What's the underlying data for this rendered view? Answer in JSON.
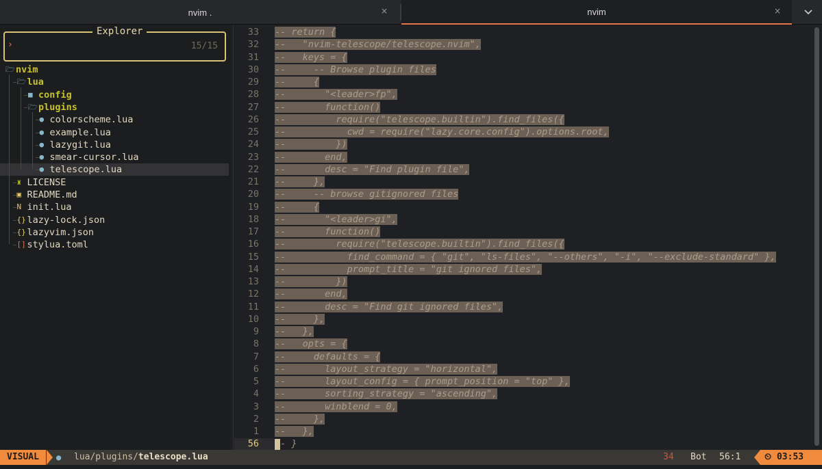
{
  "tabs": [
    {
      "label": "nvim .",
      "close": "×"
    },
    {
      "label": "nvim",
      "close": "×"
    }
  ],
  "tab_menu_icon": "chevron-down-icon",
  "explorer": {
    "title": "Explorer",
    "prompt": "›",
    "count": "15/15",
    "tree": [
      {
        "label": "nvim",
        "type": "dir",
        "icon": "folder-open-icon",
        "depth": 0
      },
      {
        "label": "lua",
        "type": "dir",
        "icon": "folder-open-icon",
        "depth": 1
      },
      {
        "label": "config",
        "type": "dir",
        "icon": "folder-icon",
        "depth": 2
      },
      {
        "label": "plugins",
        "type": "dir",
        "icon": "folder-open-icon",
        "depth": 2
      },
      {
        "label": "colorscheme.lua",
        "type": "file",
        "icon": "lua-icon",
        "depth": 3
      },
      {
        "label": "example.lua",
        "type": "file",
        "icon": "lua-icon",
        "depth": 3
      },
      {
        "label": "lazygit.lua",
        "type": "file",
        "icon": "lua-icon",
        "depth": 3
      },
      {
        "label": "smear-cursor.lua",
        "type": "file",
        "icon": "lua-icon",
        "depth": 3
      },
      {
        "label": "telescope.lua",
        "type": "file",
        "icon": "lua-icon",
        "depth": 3,
        "selected": true
      },
      {
        "label": "LICENSE",
        "type": "file",
        "icon": "license-icon",
        "depth": 1
      },
      {
        "label": "README.md",
        "type": "file",
        "icon": "markdown-icon",
        "depth": 1
      },
      {
        "label": "init.lua",
        "type": "file",
        "icon": "nvim-icon",
        "depth": 1
      },
      {
        "label": "lazy-lock.json",
        "type": "file",
        "icon": "json-icon",
        "depth": 1
      },
      {
        "label": "lazyvim.json",
        "type": "file",
        "icon": "json-icon",
        "depth": 1
      },
      {
        "label": "stylua.toml",
        "type": "file",
        "icon": "toml-icon",
        "depth": 1
      }
    ]
  },
  "editor": {
    "lines": [
      {
        "n": "33",
        "text": "-- return {"
      },
      {
        "n": "32",
        "text": "--   \"nvim-telescope/telescope.nvim\","
      },
      {
        "n": "31",
        "text": "--   keys = {"
      },
      {
        "n": "30",
        "text": "--     -- Browse plugin files"
      },
      {
        "n": "29",
        "text": "--     {"
      },
      {
        "n": "28",
        "text": "--       \"<leader>fp\","
      },
      {
        "n": "27",
        "text": "--       function()"
      },
      {
        "n": "26",
        "text": "--         require(\"telescope.builtin\").find_files({"
      },
      {
        "n": "25",
        "text": "--           cwd = require(\"lazy.core.config\").options.root,"
      },
      {
        "n": "24",
        "text": "--         })"
      },
      {
        "n": "23",
        "text": "--       end,"
      },
      {
        "n": "22",
        "text": "--       desc = \"Find plugin file\","
      },
      {
        "n": "21",
        "text": "--     },"
      },
      {
        "n": "20",
        "text": "--     -- browse gitignored files"
      },
      {
        "n": "19",
        "text": "--     {"
      },
      {
        "n": "18",
        "text": "--       \"<leader>gi\","
      },
      {
        "n": "17",
        "text": "--       function()"
      },
      {
        "n": "16",
        "text": "--         require(\"telescope.builtin\").find_files({"
      },
      {
        "n": "15",
        "text": "--           find_command = { \"git\", \"ls-files\", \"--others\", \"-i\", \"--exclude-standard\" },"
      },
      {
        "n": "14",
        "text": "--           prompt_title = \"git ignored files\","
      },
      {
        "n": "13",
        "text": "--         })"
      },
      {
        "n": "12",
        "text": "--       end,"
      },
      {
        "n": "11",
        "text": "--       desc = \"Find git ignored files\","
      },
      {
        "n": "10",
        "text": "--     },"
      },
      {
        "n": "9",
        "text": "--   },"
      },
      {
        "n": "8",
        "text": "--   opts = {"
      },
      {
        "n": "7",
        "text": "--     defaults = {"
      },
      {
        "n": "6",
        "text": "--       layout_strategy = \"horizontal\","
      },
      {
        "n": "5",
        "text": "--       layout_config = { prompt_position = \"top\" },"
      },
      {
        "n": "4",
        "text": "--       sorting_strategy = \"ascending\","
      },
      {
        "n": "3",
        "text": "--       winblend = 0,"
      },
      {
        "n": "2",
        "text": "--     },"
      },
      {
        "n": "1",
        "text": "--   },"
      },
      {
        "n": "56",
        "text": "-- }",
        "current": true
      }
    ]
  },
  "status": {
    "mode": "VISUAL",
    "file_icon": "lua-icon",
    "path_prefix": "lua/plugins/",
    "path_file": "telescope.lua",
    "selection_count": "34",
    "position_label": "Bot",
    "cursor_pos": "56:1",
    "clock_icon": "clock-icon",
    "time": "03:53"
  },
  "colors": {
    "accent": "#f08a3c",
    "directory": "#c7c22f",
    "selection_bg": "#6c5f55",
    "current_line_nr": "#e6d178"
  }
}
